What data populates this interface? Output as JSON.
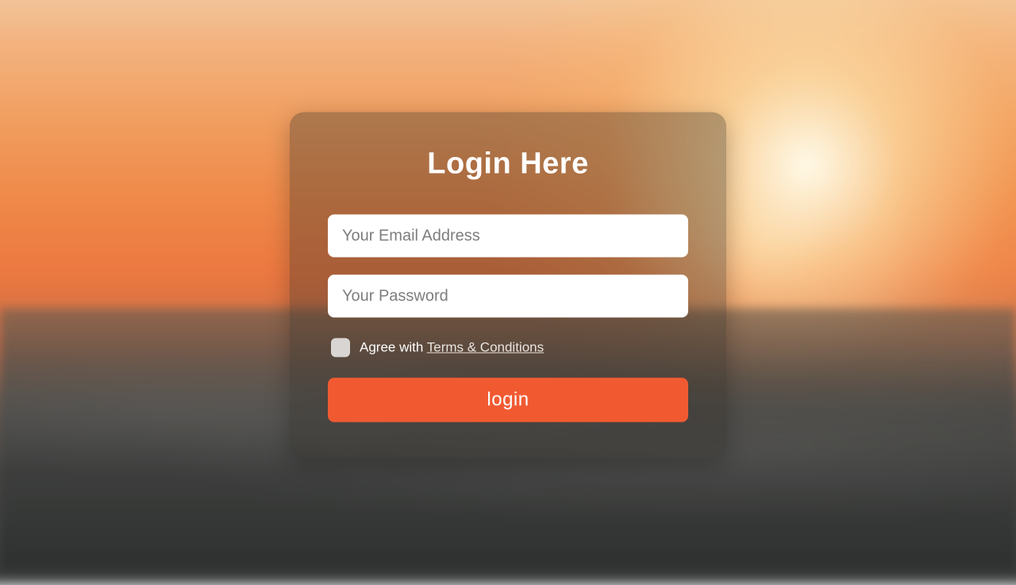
{
  "card": {
    "title": "Login Here",
    "email_placeholder": "Your Email Address",
    "password_placeholder": "Your Password",
    "agree_prefix": "Agree with ",
    "terms_label": "Terms & Conditions",
    "submit_label": "login"
  },
  "colors": {
    "accent": "#f15a31"
  }
}
